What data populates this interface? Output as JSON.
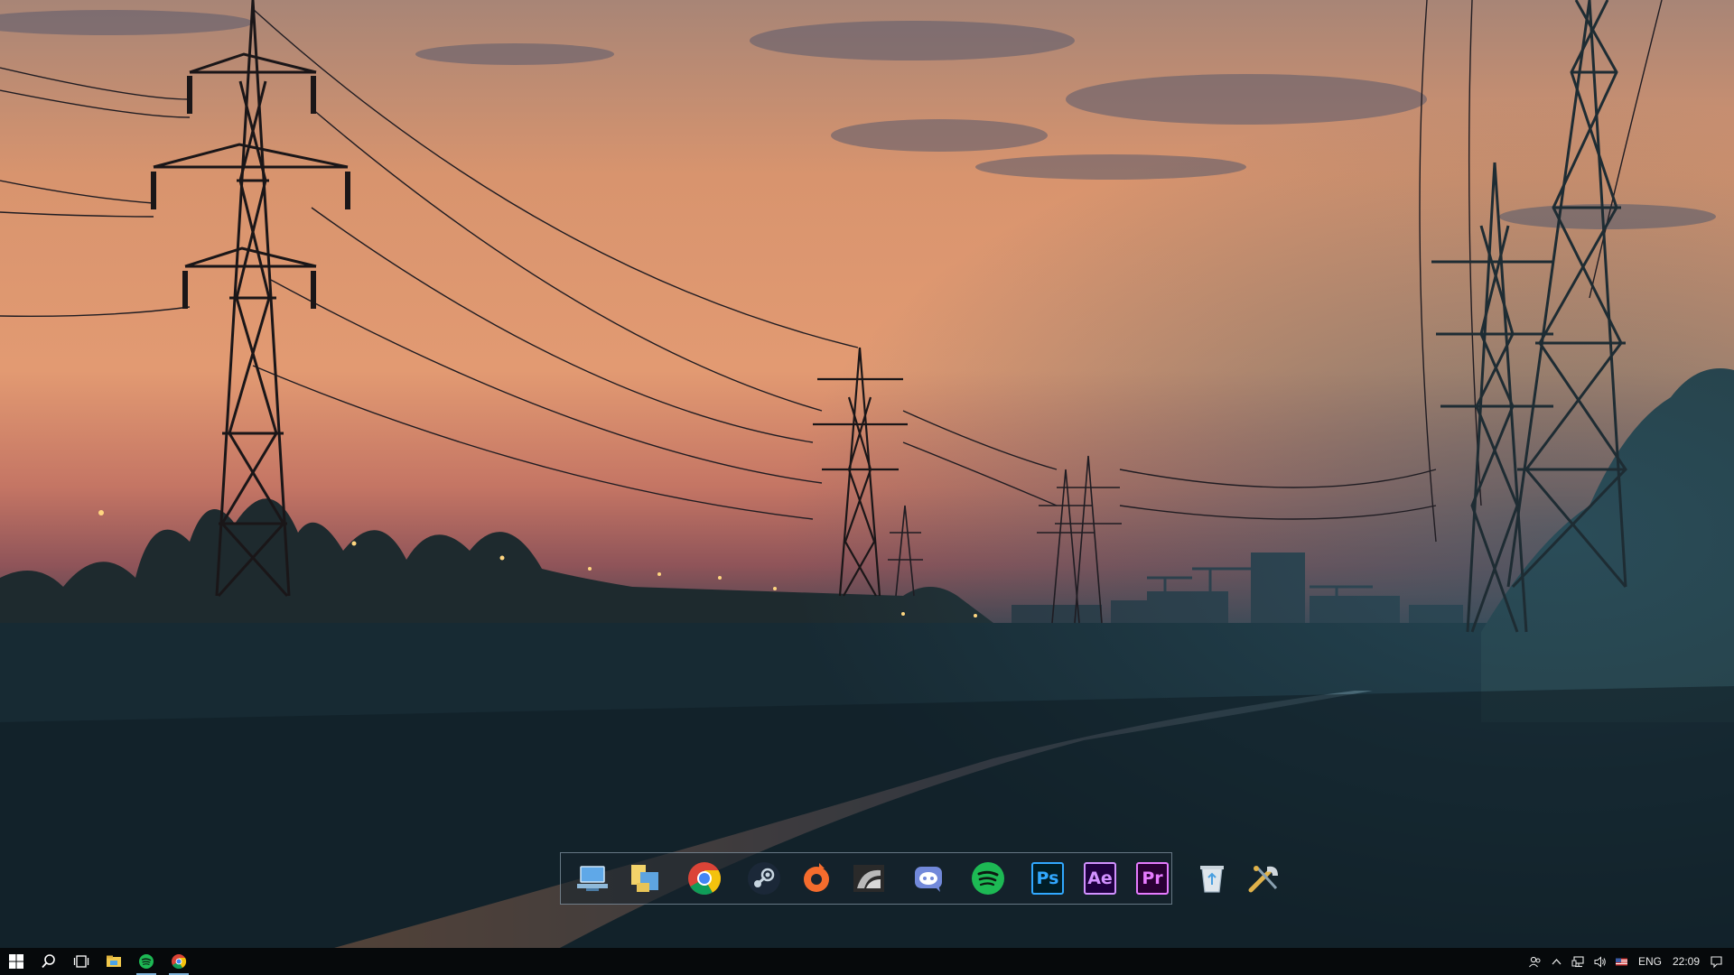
{
  "wallpaper": {
    "description_colors": {
      "sky_top": "#b9876b",
      "sky_mid": "#d98c68",
      "horizon": "#a35f5c",
      "ground": "#16262f"
    }
  },
  "dock": {
    "groups": [
      [
        {
          "icon": "this-pc-icon",
          "label": "This PC"
        },
        {
          "icon": "file-explorer-icon",
          "label": "File Explorer"
        }
      ],
      [
        {
          "icon": "chrome-icon",
          "label": "Google Chrome"
        }
      ],
      [
        {
          "icon": "steam-icon",
          "label": "Steam"
        },
        {
          "icon": "origin-icon",
          "label": "Origin"
        },
        {
          "icon": "geforce-experience-icon",
          "label": "GeForce Experience"
        }
      ],
      [
        {
          "icon": "discord-icon",
          "label": "Discord"
        }
      ],
      [
        {
          "icon": "spotify-icon",
          "label": "Spotify"
        }
      ],
      [
        {
          "icon": "photoshop-icon",
          "label": "Ps"
        },
        {
          "icon": "after-effects-icon",
          "label": "Ae"
        },
        {
          "icon": "premiere-icon",
          "label": "Pr"
        }
      ],
      [
        {
          "icon": "recycle-bin-icon",
          "label": "Recycle Bin"
        },
        {
          "icon": "settings-tools-icon",
          "label": "Tools"
        }
      ]
    ],
    "adobe": {
      "ps": {
        "text": "Ps",
        "bg": "#001d26",
        "fg": "#31a8ff"
      },
      "ae": {
        "text": "Ae",
        "bg": "#1f0040",
        "fg": "#d291ff"
      },
      "pr": {
        "text": "Pr",
        "bg": "#2a0034",
        "fg": "#e77bff"
      }
    }
  },
  "taskbar": {
    "left": [
      {
        "icon": "windows-start-icon"
      },
      {
        "icon": "search-icon"
      },
      {
        "icon": "task-view-icon"
      },
      {
        "icon": "file-explorer-icon"
      },
      {
        "icon": "spotify-icon",
        "running": true
      },
      {
        "icon": "chrome-icon",
        "running": true
      }
    ],
    "tray": {
      "language": "ENG",
      "time": "22:09"
    }
  }
}
